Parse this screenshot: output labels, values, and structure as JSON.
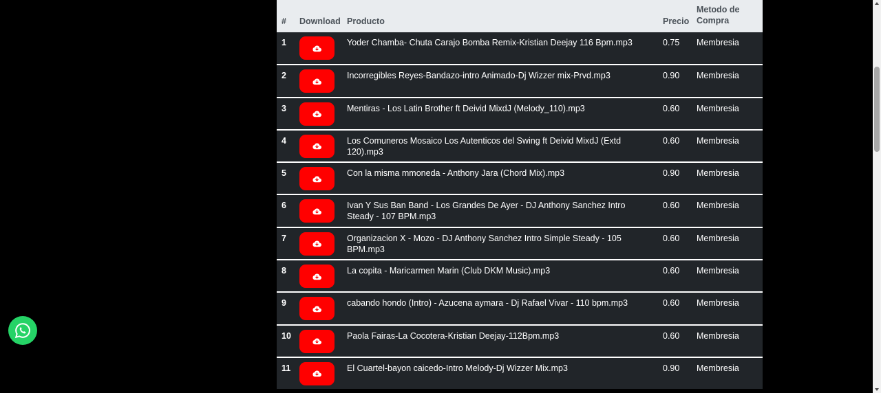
{
  "table": {
    "headers": {
      "num": "#",
      "download": "Download",
      "product": "Producto",
      "price": "Precio",
      "method": "Metodo de Compra"
    },
    "rows": [
      {
        "num": "1",
        "product": "Yoder Chamba- Chuta Carajo Bomba Remix-Kristian Deejay 116 Bpm.mp3",
        "price": "0.75",
        "method": "Membresia"
      },
      {
        "num": "2",
        "product": "Incorregibles Reyes-Bandazo-intro Animado-Dj Wizzer mix-Prvd.mp3",
        "price": "0.90",
        "method": "Membresia"
      },
      {
        "num": "3",
        "product": "Mentiras - Los Latin Brother ft Deivid MixdJ (Melody_110).mp3",
        "price": "0.60",
        "method": "Membresia"
      },
      {
        "num": "4",
        "product": "Los Comuneros Mosaico Los Autenticos del Swing ft Deivid MixdJ (Extd 120).mp3",
        "price": "0.60",
        "method": "Membresia"
      },
      {
        "num": "5",
        "product": "Con la misma mmoneda - Anthony Jara (Chord Mix).mp3",
        "price": "0.90",
        "method": "Membresia"
      },
      {
        "num": "6",
        "product": "Ivan Y Sus Ban Band - Los Grandes De Ayer - DJ Anthony Sanchez Intro Steady - 107 BPM.mp3",
        "price": "0.60",
        "method": "Membresia"
      },
      {
        "num": "7",
        "product": "Organizacion X - Mozo - DJ Anthony Sanchez Intro Simple Steady - 105 BPM.mp3",
        "price": "0.60",
        "method": "Membresia"
      },
      {
        "num": "8",
        "product": "La copita - Maricarmen Marin (Club DKM Music).mp3",
        "price": "0.60",
        "method": "Membresia"
      },
      {
        "num": "9",
        "product": "cabando hondo (Intro) - Azucena aymara - Dj Rafael Vivar - 110 bpm.mp3",
        "price": "0.60",
        "method": "Membresia"
      },
      {
        "num": "10",
        "product": "Paola Fairas-La Cocotera-Kristian Deejay-112Bpm.mp3",
        "price": "0.60",
        "method": "Membresia"
      },
      {
        "num": "11",
        "product": "El Cuartel-bayon caicedo-Intro Melody-Dj Wizzer Mix.mp3",
        "price": "0.90",
        "method": "Membresia"
      }
    ]
  },
  "icons": {
    "download": "cloud-download-icon",
    "whatsapp": "whatsapp-icon"
  },
  "colors": {
    "download_button": "#ff0000",
    "table_bg": "#212529",
    "header_bg": "#e9ecef",
    "whatsapp": "#25d366"
  }
}
